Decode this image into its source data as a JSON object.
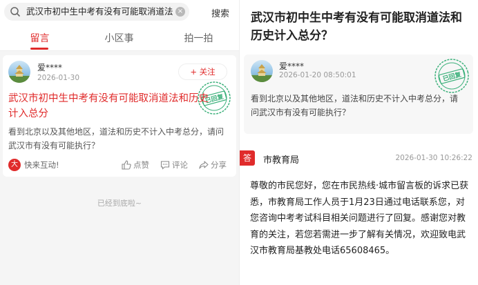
{
  "search": {
    "query": "武汉市初中生中考有没有可能取消道法和历史计入总分？",
    "clear_glyph": "×",
    "button_label": "搜索"
  },
  "tabs": [
    {
      "label": "留言",
      "active": true
    },
    {
      "label": "小区事",
      "active": false
    },
    {
      "label": "拍一拍",
      "active": false
    }
  ],
  "card": {
    "user_name": "爱****",
    "date": "2026-01-30",
    "follow_label": "+ 关注",
    "stamp_text": "已回复",
    "title": "武汉市初中生中考有没有可能取消道法和历史计入总分",
    "body": "看到北京以及其他地区，道法和历史不计入中考总分，请问武汉市有没有可能执行？",
    "brand_icon_text": "大",
    "brand_text": "快来互动!",
    "actions": {
      "like": "点赞",
      "comment": "评论",
      "share": "分享"
    }
  },
  "bottom_hint": "已经到底啦~",
  "detail": {
    "title": "武汉市初中生中考有没有可能取消道法和历史计入总分？",
    "user_name": "爱****",
    "datetime": "2026-01-20 08:50:01",
    "stamp_text": "已回复",
    "body": "看到北京以及其他地区，道法和历史不计入中考总分，请问武汉市有没有可能执行？",
    "reply": {
      "badge": "答",
      "department": "市教育局",
      "datetime": "2026-01-30 10:26:22",
      "body": "尊敬的市民您好，您在市民热线·城市留言板的诉求已获悉，市教育局工作人员于1月23日通过电话联系您，对您咨询中考考试科目相关问题进行了回复。感谢您对教育的关注，若您若需进一步了解有关情况，欢迎致电武汉市教育局基教处电话65608465。"
    }
  },
  "colors": {
    "accent": "#e02b2b",
    "stamp": "#3bb07a"
  }
}
